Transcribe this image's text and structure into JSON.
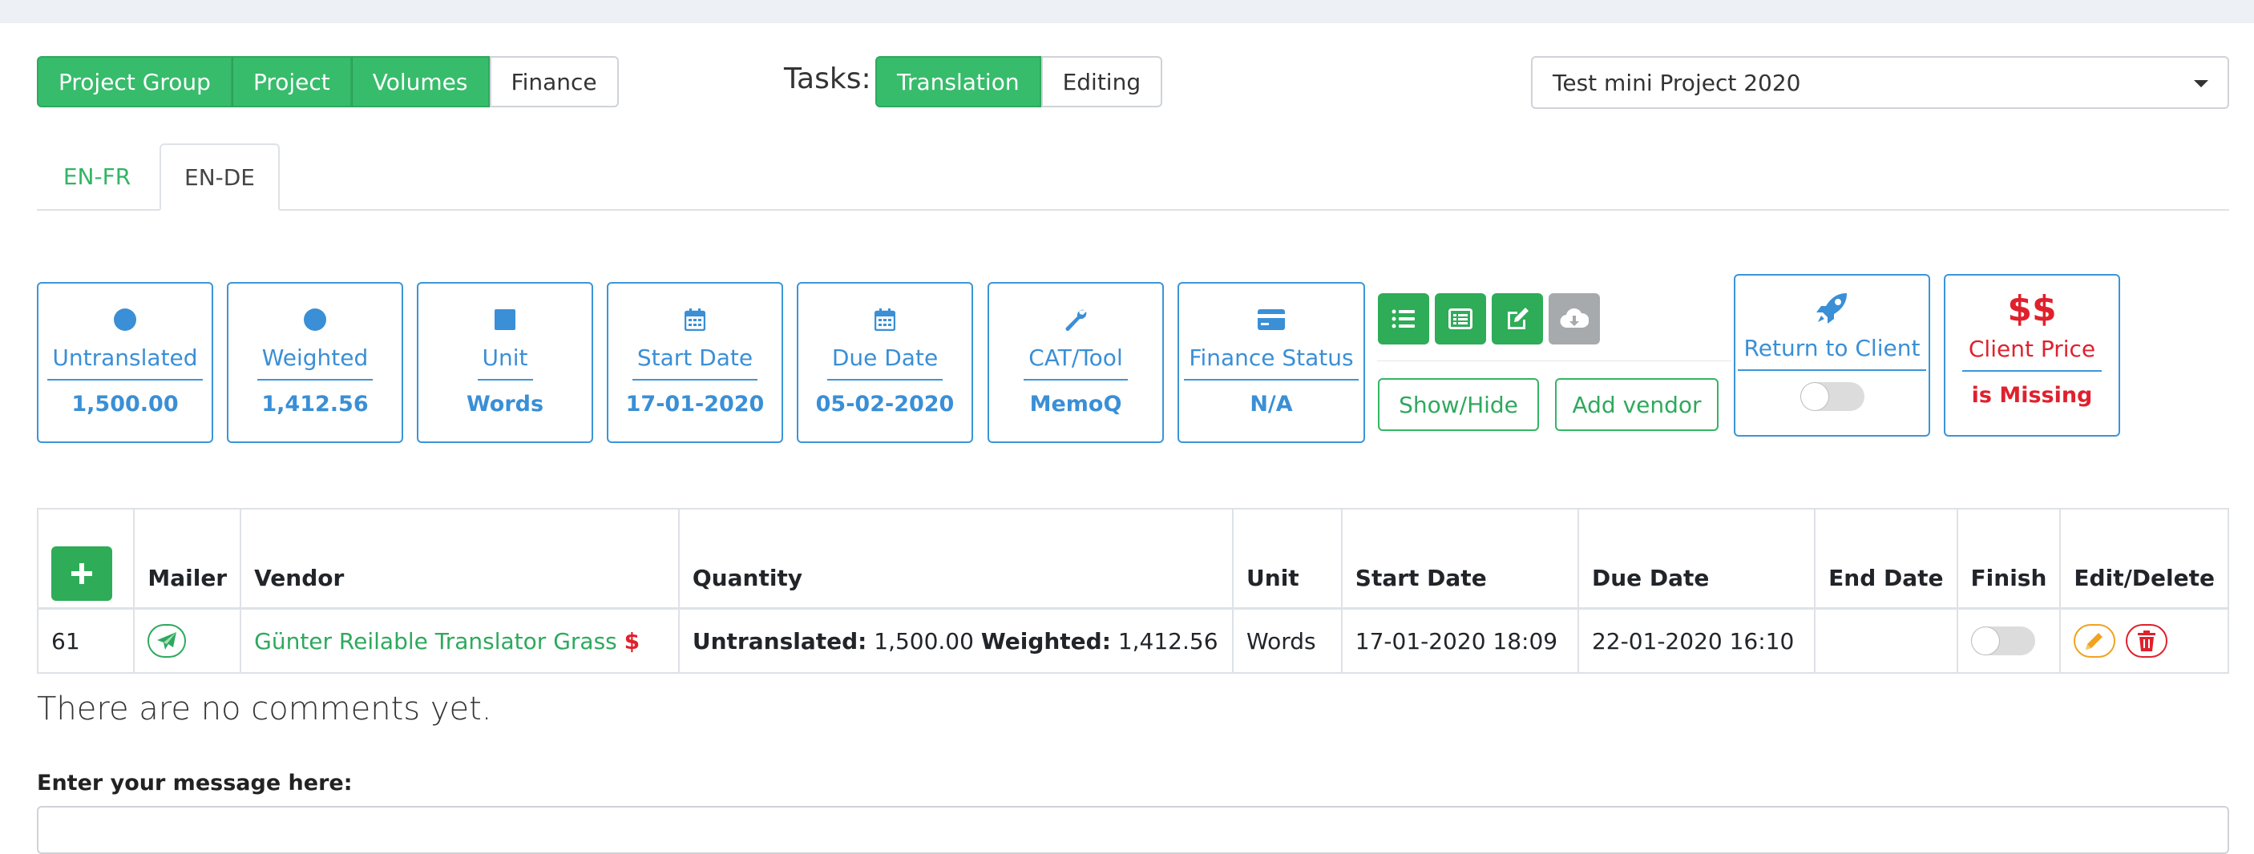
{
  "nav": {
    "items": [
      "Project Group",
      "Project",
      "Volumes",
      "Finance"
    ]
  },
  "tasks": {
    "label": "Tasks:",
    "items": [
      "Translation",
      "Editing"
    ]
  },
  "project_select": {
    "value": "Test mini Project 2020"
  },
  "lang_tabs": [
    "EN-FR",
    "EN-DE"
  ],
  "cards": [
    {
      "label": "Untranslated",
      "value": "1,500.00",
      "icon": "circle-icon"
    },
    {
      "label": "Weighted",
      "value": "1,412.56",
      "icon": "circle-icon"
    },
    {
      "label": "Unit",
      "value": "Words",
      "icon": "square-icon"
    },
    {
      "label": "Start Date",
      "value": "17-01-2020",
      "icon": "calendar-icon"
    },
    {
      "label": "Due Date",
      "value": "05-02-2020",
      "icon": "calendar-icon"
    },
    {
      "label": "CAT/Tool",
      "value": "MemoQ",
      "icon": "wrench-icon"
    },
    {
      "label": "Finance Status",
      "value": "N/A",
      "icon": "credit-card-icon"
    }
  ],
  "actions": {
    "show_hide": "Show/Hide",
    "add_vendor": "Add vendor"
  },
  "return_client": {
    "label": "Return to Client"
  },
  "client_price": {
    "symbol": "$$",
    "label": "Client Price",
    "status": "is Missing"
  },
  "table": {
    "headers": [
      "Mailer",
      "Vendor",
      "Quantity",
      "Unit",
      "Start Date",
      "Due Date",
      "End Date",
      "Finish",
      "Edit/Delete"
    ],
    "rows": [
      {
        "id": "61",
        "vendor": "Günter Reilable Translator Grass",
        "vendor_badge": "$",
        "qty_untranslated_label": "Untranslated:",
        "qty_untranslated": "1,500.00",
        "qty_weighted_label": "Weighted:",
        "qty_weighted": "1,412.56",
        "unit": "Words",
        "start": "17-01-2020 18:09",
        "due": "22-01-2020 16:10",
        "end": ""
      }
    ]
  },
  "comments": {
    "empty_text": "There are no comments yet.",
    "message_label": "Enter your message here:"
  },
  "colors": {
    "green": "#37bc6b",
    "blue": "#3a8fd6",
    "red": "#e0212d",
    "orange": "#f0a31c"
  }
}
